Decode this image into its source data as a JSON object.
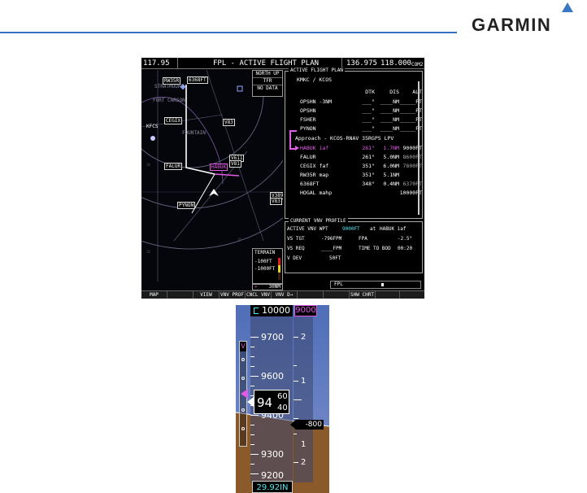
{
  "header": {
    "brand": "GARMIN"
  },
  "mfd": {
    "topbar": {
      "nav_freq": "117.95",
      "title": "FPL - ACTIVE FLIGHT PLAN",
      "com_standby": "136.975",
      "com_active": "118.000",
      "com_label": "COM2"
    },
    "map": {
      "north_up": "NORTH UP",
      "tfr": "TFR",
      "no_data": "NO DATA",
      "labels": {
        "rw35r": "RW35R",
        "mda": "6368FT",
        "stratmoore": "STRATMOORE",
        "fort_carson": "FORT CARSON",
        "cegix": "CEGIX",
        "kfcs": "KFCS",
        "fountain": "FOUNTAIN",
        "v83": "V83",
        "v611": "V611",
        "v81": "V81",
        "falur": "FALUR",
        "habuk": "HABUK",
        "pynon": "PYNON",
        "v389": "V389",
        "v83b": "V83"
      },
      "terrain": {
        "title": "TERRAIN",
        "level1": "-100FT",
        "level2": "-1000FT",
        "colors": [
          "#e11b1b",
          "#e6d021",
          "#3a1a08"
        ]
      },
      "range": "30NM"
    },
    "flight_plan": {
      "title": "ACTIVE FLIGHT PLAN",
      "route": "KMKC / KCOS",
      "headers": {
        "dtk": "DTK",
        "dis": "DIS",
        "alt": "ALT"
      },
      "rows": [
        {
          "wpt": "OPSHN -3NM",
          "dtk": "___°",
          "dis": "____NM",
          "alt": "_____FT"
        },
        {
          "wpt": "OPSHN",
          "dtk": "___°",
          "dis": "____NM",
          "alt": "_____FT"
        },
        {
          "wpt": "FSHER",
          "dtk": "___°",
          "dis": "____NM",
          "alt": "_____FT"
        },
        {
          "wpt": "PYNON",
          "dtk": "___°",
          "dis": "____NM",
          "alt": "_____FT"
        }
      ],
      "approach": "Approach - KCOS-RNAV 35RGPS LPV",
      "approach_rows": [
        {
          "wpt": "HABUK iaf",
          "dtk": "261°",
          "dis": "1.7NM",
          "alt": "9000FT"
        },
        {
          "wpt": "FALUR",
          "dtk": "261°",
          "dis": "5.0NM",
          "alt": "8600FT"
        },
        {
          "wpt": "CEGIX faf",
          "dtk": "351°",
          "dis": "6.0NM",
          "alt": "7800FT"
        },
        {
          "wpt": "RW35R map",
          "dtk": "351°",
          "dis": "5.1NM",
          "alt": ""
        },
        {
          "wpt": "6368FT",
          "dtk": "348°",
          "dis": "0.4NM",
          "alt": "6370FT"
        },
        {
          "wpt": "HOGAL mahp",
          "dtk": "",
          "dis": "",
          "alt": "10000FT"
        }
      ]
    },
    "vnv_profile": {
      "title": "CURRENT VNV PROFILE",
      "active_label": "ACTIVE VNV WPT",
      "active_value": "9000FT",
      "active_at": "at",
      "active_wpt": "HABUK iaf",
      "vs_tgt_label": "VS TGT",
      "vs_tgt_value": "-796FPM",
      "fpa_label": "FPA",
      "fpa_value": "-2.5°",
      "vs_req_label": "VS REQ",
      "vs_req_value": "____FPM",
      "tod_label": "TIME TO BOD",
      "tod_value": "00:20",
      "vdev_label": "V DEV",
      "vdev_value": "50FT"
    },
    "fpl_bar": {
      "label": "FPL"
    },
    "softkeys": [
      "MAP",
      "",
      "VIEW",
      "VNV PROF",
      "CNCL VNV",
      "VNV D→",
      "",
      "",
      "SHW CHRT",
      "",
      ""
    ]
  },
  "pfd": {
    "selected_altitude": "10000",
    "vnv_target": "9000",
    "altitude_labels": [
      "9700",
      "9600",
      "9500",
      "9400",
      "9300",
      "9200"
    ],
    "vsi_labels": [
      "2",
      "1",
      "1",
      "2"
    ],
    "readout_main": "94",
    "readout_upper": "60",
    "readout_lower": "40",
    "vdev_label": "V",
    "vertical_speed": "-800",
    "baro": "29.92IN",
    "colors": {
      "cyan": "#53e6f2",
      "magenta": "#e25ae8"
    }
  }
}
